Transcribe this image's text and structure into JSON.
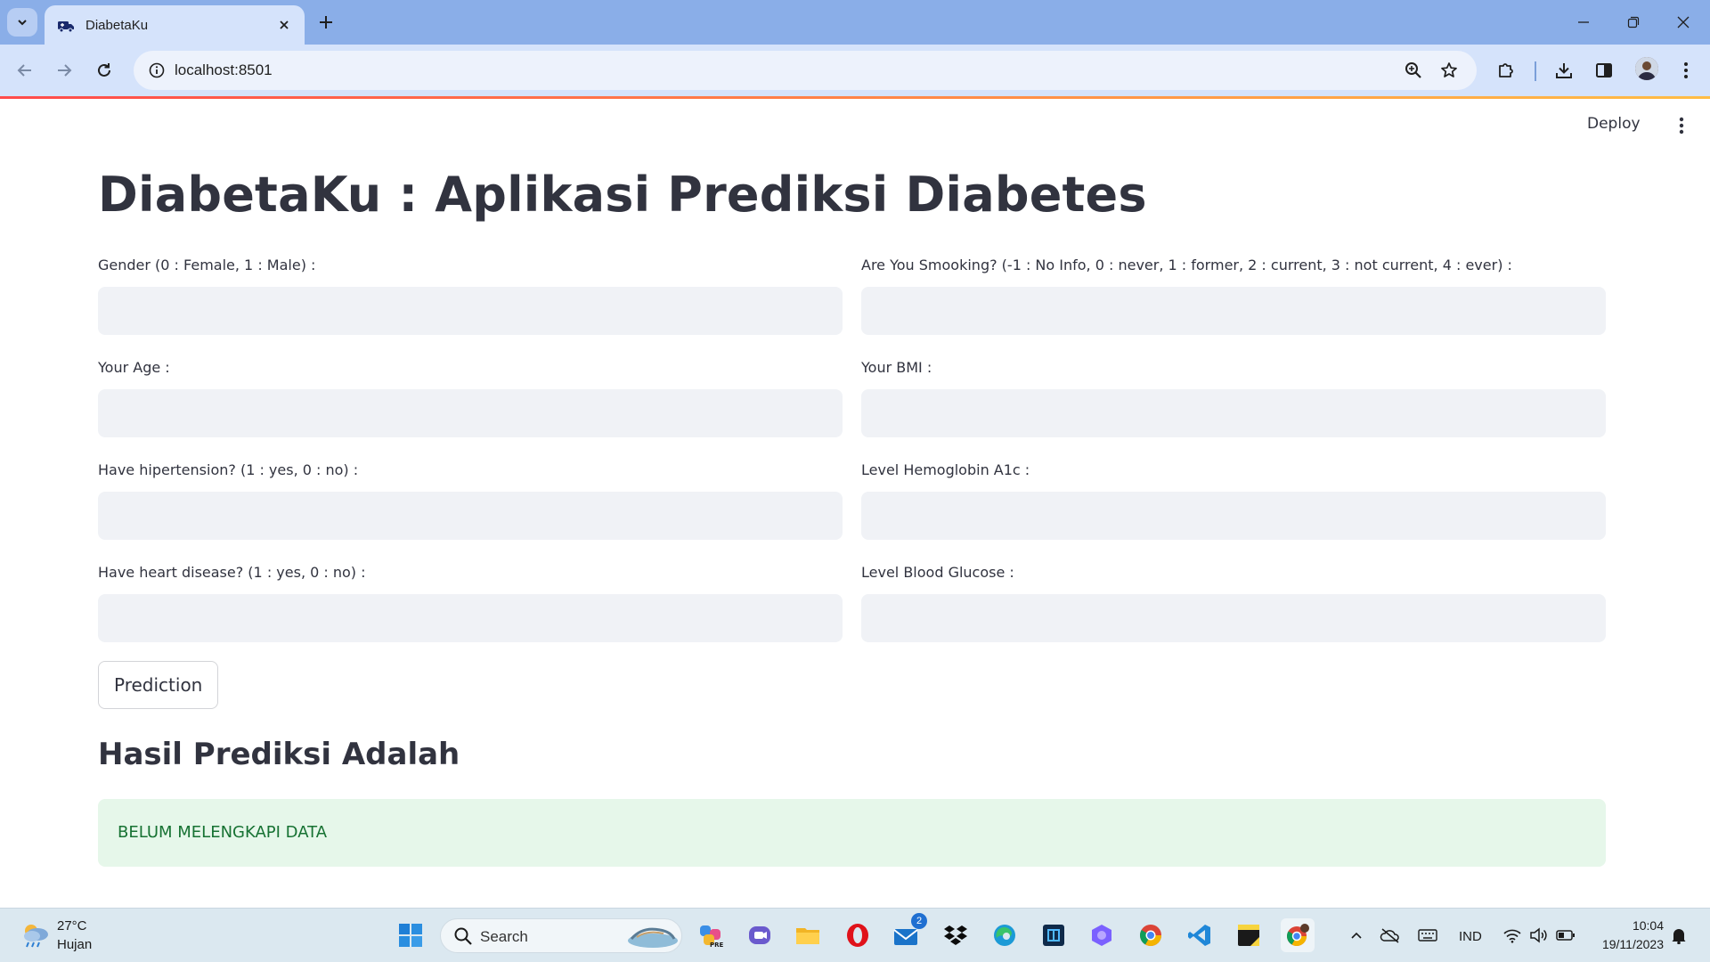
{
  "browser": {
    "tab_title": "DiabetaKu",
    "url": "localhost:8501"
  },
  "app": {
    "deploy_label": "Deploy",
    "title": "DiabetaKu : Aplikasi Prediksi Diabetes",
    "fields": {
      "gender": {
        "label": "Gender (0 : Female, 1 : Male) :",
        "value": ""
      },
      "smoking": {
        "label": "Are You Smooking? (-1 : No Info, 0 : never, 1 : former, 2 : current, 3 : not current, 4 : ever) :",
        "value": ""
      },
      "age": {
        "label": "Your Age :",
        "value": ""
      },
      "bmi": {
        "label": "Your BMI :",
        "value": ""
      },
      "hipertension": {
        "label": "Have hipertension? (1 : yes, 0 : no) :",
        "value": ""
      },
      "hba1c": {
        "label": "Level Hemoglobin A1c :",
        "value": ""
      },
      "heart": {
        "label": "Have heart disease? (1 : yes, 0 : no) :",
        "value": ""
      },
      "glucose": {
        "label": "Level Blood Glucose :",
        "value": ""
      }
    },
    "predict_button": "Prediction",
    "result_heading": "Hasil Prediksi Adalah",
    "result_text": "BELUM MELENGKAPI DATA"
  },
  "taskbar": {
    "weather_temp": "27°C",
    "weather_desc": "Hujan",
    "search_label": "Search",
    "mail_badge": "2",
    "language": "IND",
    "time": "10:04",
    "date": "19/11/2023"
  },
  "colors": {
    "accent_start": "#ff4b4b",
    "accent_end": "#ffbd45",
    "success_bg": "#e6f7ea",
    "success_text": "#177233"
  }
}
